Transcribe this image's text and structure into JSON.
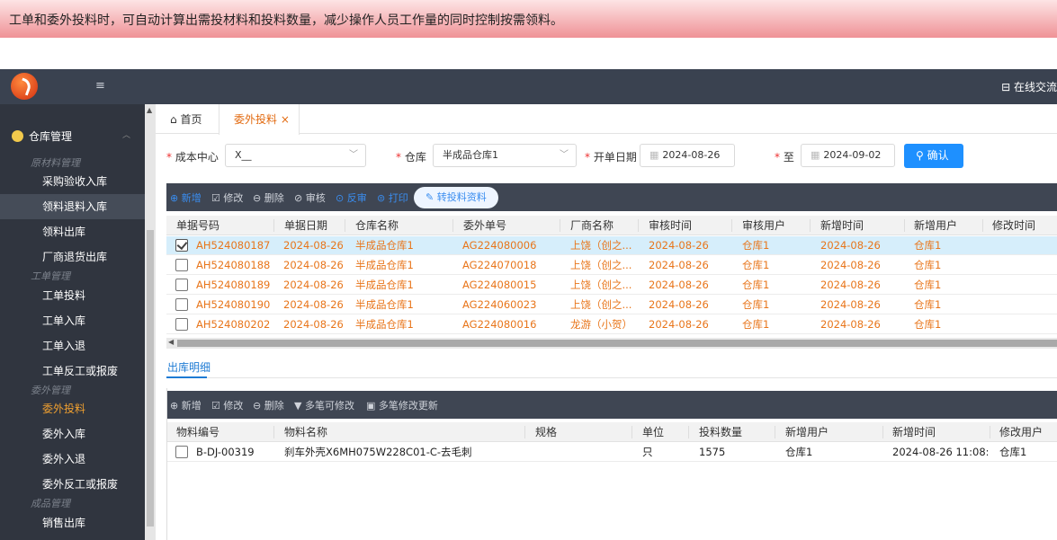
{
  "banner": {
    "text": "工单和委外投料时，可自动计算出需投材料和投料数量，减少操作人员工作量的同时控制按需领料。"
  },
  "topbar": {
    "menu_icon": "≡",
    "chat_label": "在线交流"
  },
  "sidebar": {
    "section": "仓库管理",
    "groups": {
      "raw": "原材料管理",
      "work": "工单管理",
      "outsource": "委外管理",
      "finished": "成品管理"
    },
    "items": [
      "采购验收入库",
      "领料退料入库",
      "领料出库",
      "厂商退货出库",
      "工单投料",
      "工单入库",
      "工单入退",
      "工单反工或报废",
      "委外投料",
      "委外入库",
      "委外入退",
      "委外反工或报废",
      "销售出库"
    ]
  },
  "tabs": {
    "home": "首页",
    "active": "委外投料",
    "close": "×"
  },
  "filters": {
    "cost_center_label": "成本中心",
    "cost_center_value": "X__",
    "warehouse_label": "仓库",
    "warehouse_value": "半成品仓库1",
    "open_date_label": "开单日期",
    "date_from": "2024-08-26",
    "to_label": "至",
    "date_to": "2024-09-02",
    "confirm": "确认"
  },
  "toolbar1": {
    "add": "新增",
    "edit": "修改",
    "delete": "删除",
    "audit": "审核",
    "unaudit": "反审",
    "print": "打印",
    "transfer": "转投料资料"
  },
  "main_grid": {
    "headers": [
      "单据号码",
      "单据日期",
      "仓库名称",
      "委外单号",
      "厂商名称",
      "审核时间",
      "审核用户",
      "新增时间",
      "新增用户",
      "修改时间"
    ],
    "rows": [
      [
        "AH524080187",
        "2024-08-26",
        "半成品仓库1",
        "AG224080006",
        "上饶（创之...",
        "2024-08-26",
        "仓库1",
        "2024-08-26",
        "仓库1"
      ],
      [
        "AH524080188",
        "2024-08-26",
        "半成品仓库1",
        "AG224070018",
        "上饶（创之...",
        "2024-08-26",
        "仓库1",
        "2024-08-26",
        "仓库1"
      ],
      [
        "AH524080189",
        "2024-08-26",
        "半成品仓库1",
        "AG224080015",
        "上饶（创之...",
        "2024-08-26",
        "仓库1",
        "2024-08-26",
        "仓库1"
      ],
      [
        "AH524080190",
        "2024-08-26",
        "半成品仓库1",
        "AG224060023",
        "上饶（创之...",
        "2024-08-26",
        "仓库1",
        "2024-08-26",
        "仓库1"
      ],
      [
        "AH524080202",
        "2024-08-26",
        "半成品仓库1",
        "AG224080016",
        "龙游（小贺）",
        "2024-08-26",
        "仓库1",
        "2024-08-26",
        "仓库1"
      ]
    ]
  },
  "detail": {
    "title": "出库明细",
    "toolbar": {
      "add": "新增",
      "edit": "修改",
      "delete": "删除",
      "multi_edit": "多笔可修改",
      "multi_update": "多笔修改更新"
    },
    "headers": [
      "物料编号",
      "物料名称",
      "规格",
      "单位",
      "投料数量",
      "新增用户",
      "新增时间",
      "修改用户"
    ],
    "rows": [
      [
        "B-DJ-00319",
        "刹车外壳X6MH075W228C01-C-去毛刺",
        "",
        "只",
        "1575",
        "仓库1",
        "2024-08-26 11:08:...",
        "仓库1"
      ]
    ]
  }
}
